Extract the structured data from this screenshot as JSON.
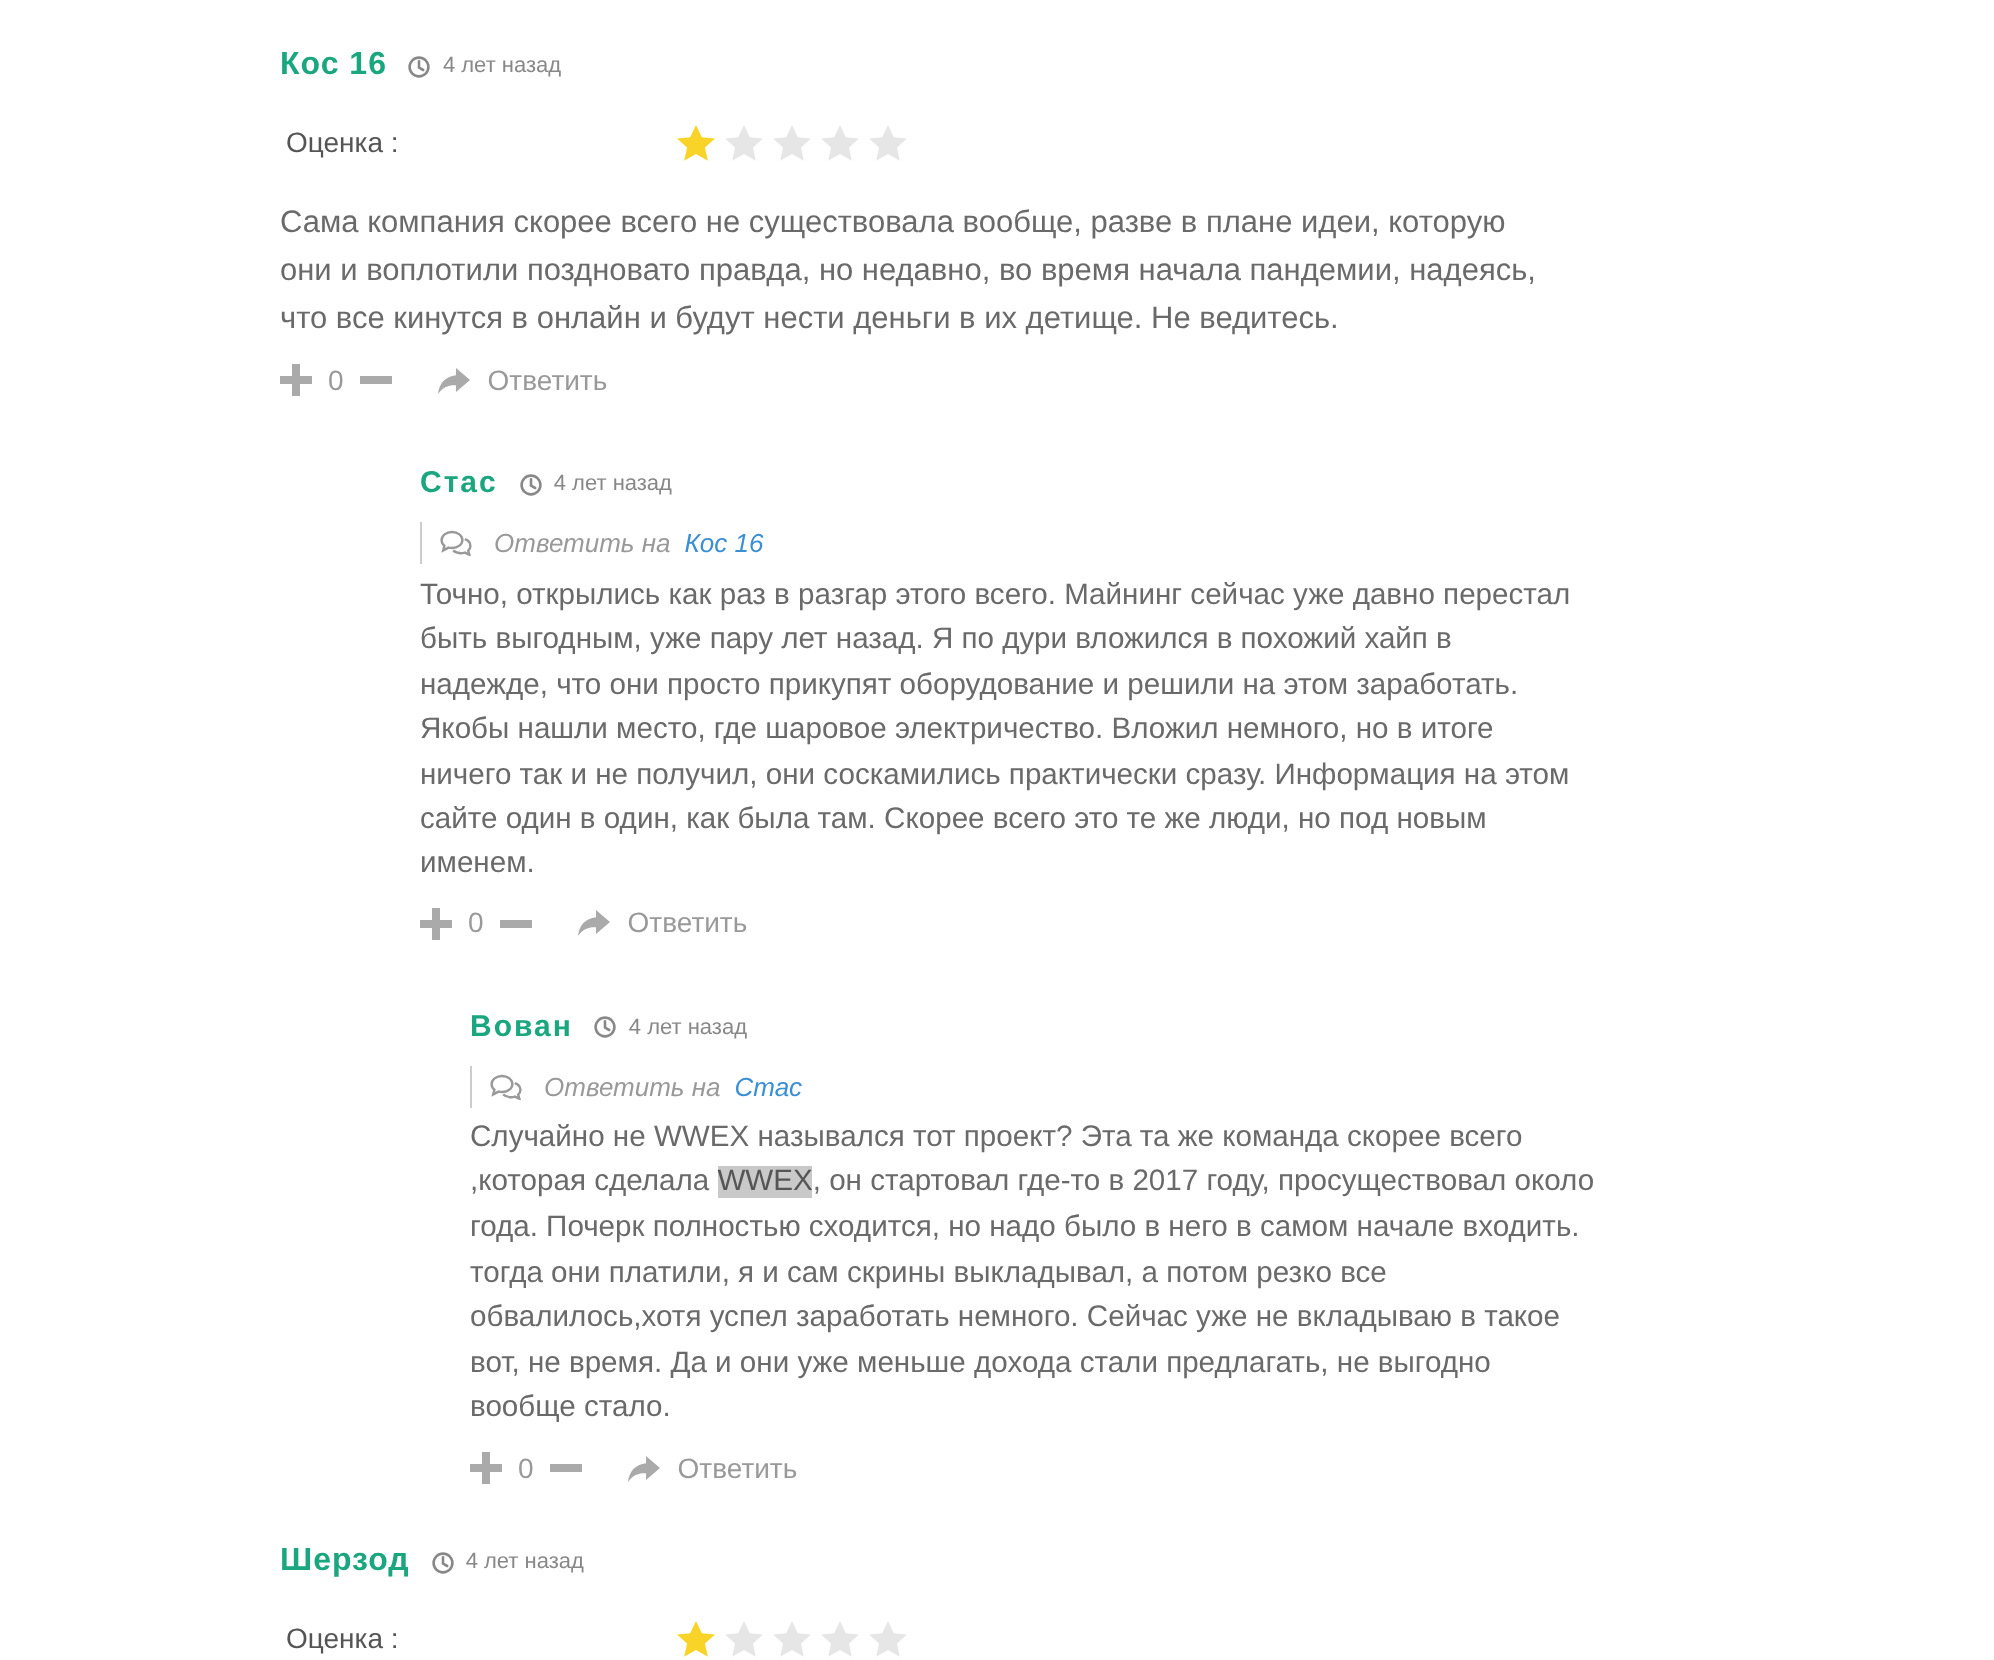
{
  "comments": [
    {
      "author": "Кос 16",
      "time": "4 лет назад",
      "rating": {
        "label": "Оценка :",
        "stars": 1
      },
      "text": [
        {
          "text": "Сама компания скорее всего не существовала вообще, разве в плане идеи, которую они и воплотили поздновато правда, но недавно, во время начала пандемии, надеясь, что все кинутся в онлайн и будут нести деньги в их детище. Не ведитесь.",
          "highlighted": false
        }
      ],
      "votes": "0",
      "reply": "Ответить",
      "children": [
        {
          "author": "Стас",
          "time": "4 лет назад",
          "reply_to": {
            "label": "Ответить на",
            "name": "Кос 16"
          },
          "text": [
            {
              "text": "Точно, открылись как раз в разгар этого всего. Майнинг сейчас уже давно перестал быть выгодным, уже пару лет назад. Я по дури вложился в похожий хайп в надежде, что они просто прикупят оборудование и решили на этом заработать. Якобы нашли место, где шаровое электричество. Вложил немного, но в итоге ничего так и не получил, они соскамились практически сразу. Информация на этом сайте один в один, как была там. Скорее всего это те же люди, но под новым именем.",
              "highlighted": false
            }
          ],
          "votes": "0",
          "reply": "Ответить",
          "children": [
            {
              "author": "Вован",
              "time": "4 лет назад",
              "reply_to": {
                "label": "Ответить на",
                "name": "Стас"
              },
              "text": [
                {
                  "text": "Случайно не WWEX назывался тот проект? Эта та же команда скорее всего ,которая сделала ",
                  "highlighted": false
                },
                {
                  "text": "WWEX",
                  "highlighted": true
                },
                {
                  "text": ", он стартовал где-то в 2017 году, просуществовал около года. Почерк полностью сходится, но надо было в него в самом начале входить. тогда они платили, я и сам скрины выкладывал, а потом резко все обвалилось,хотя успел заработать немного. Сейчас уже не вкладываю в такое вот, не время. Да и они уже меньше дохода стали предлагать, не выгодно вообще стало.",
                  "highlighted": false
                }
              ],
              "votes": "0",
              "reply": "Ответить"
            }
          ]
        }
      ]
    },
    {
      "author": "Шерзод",
      "time": "4 лет назад",
      "rating": {
        "label": "Оценка :",
        "stars": 1
      }
    }
  ]
}
